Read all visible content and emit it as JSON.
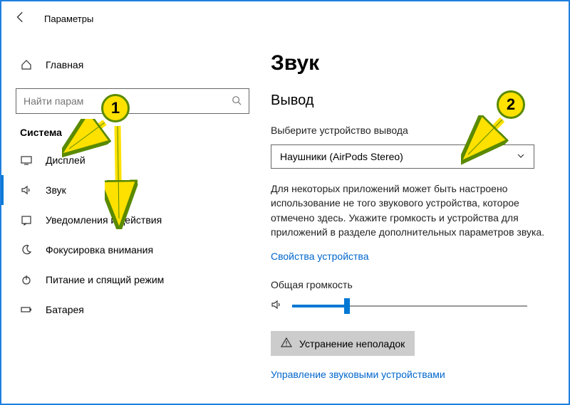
{
  "header": {
    "title": "Параметры"
  },
  "sidebar": {
    "home": "Главная",
    "search_placeholder": "Найти парам",
    "section": "Система",
    "items": [
      {
        "label": "Дисплей"
      },
      {
        "label": "Звук"
      },
      {
        "label": "Уведомления и действия"
      },
      {
        "label": "Фокусировка внимания"
      },
      {
        "label": "Питание и спящий режим"
      },
      {
        "label": "Батарея"
      }
    ]
  },
  "content": {
    "title": "Звук",
    "output": "Вывод",
    "choose_device": "Выберите устройство вывода",
    "device_value": "Наушники (AirPods Stereo)",
    "description": "Для некоторых приложений может быть настроено использование не того звукового устройства, которое отмечено здесь. Укажите громкость и устройства для приложений в разделе дополнительных параметров звука.",
    "device_properties": "Свойства устройства",
    "volume_label": "Общая громкость",
    "troubleshoot": "Устранение неполадок",
    "manage_devices": "Управление звуковыми устройствами"
  },
  "annotations": {
    "badge1": "1",
    "badge2": "2"
  }
}
